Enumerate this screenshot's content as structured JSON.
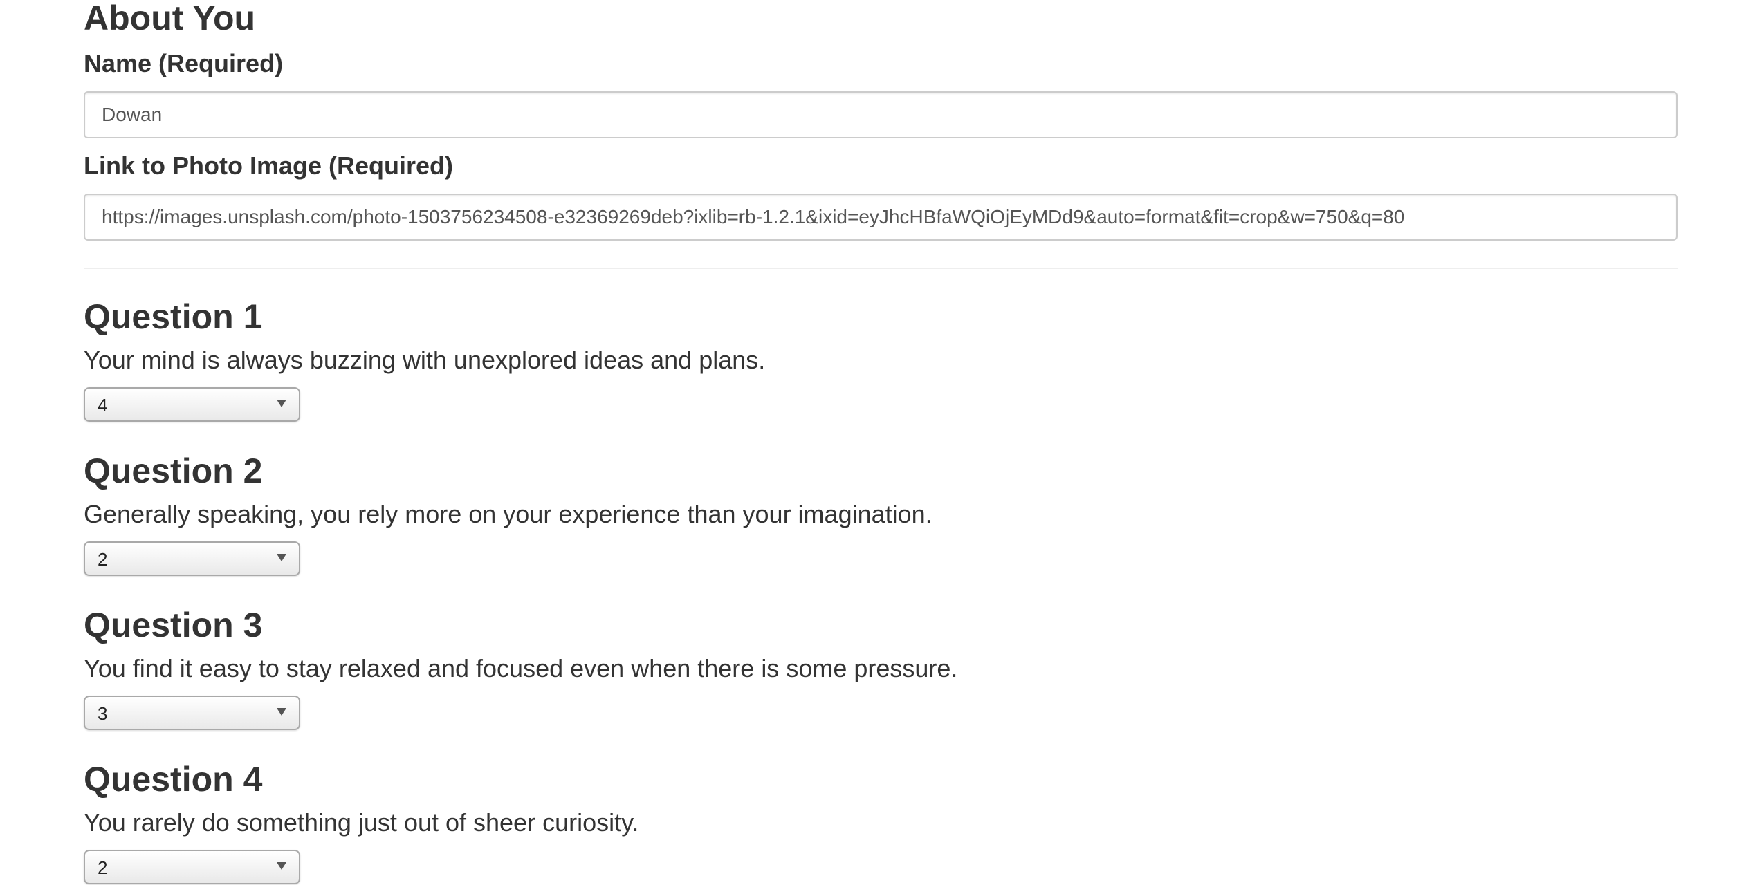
{
  "about": {
    "title": "About You",
    "name_label": "Name (Required)",
    "name_value": "Dowan",
    "photo_label": "Link to Photo Image (Required)",
    "photo_value": "https://images.unsplash.com/photo-1503756234508-e32369269deb?ixlib=rb-1.2.1&ixid=eyJhcHBfaWQiOjEyMDd9&auto=format&fit=crop&w=750&q=80"
  },
  "questions": [
    {
      "title": "Question 1",
      "text": "Your mind is always buzzing with unexplored ideas and plans.",
      "selected": "4"
    },
    {
      "title": "Question 2",
      "text": "Generally speaking, you rely more on your experience than your imagination.",
      "selected": "2"
    },
    {
      "title": "Question 3",
      "text": "You find it easy to stay relaxed and focused even when there is some pressure.",
      "selected": "3"
    },
    {
      "title": "Question 4",
      "text": "You rarely do something just out of sheer curiosity.",
      "selected": "2"
    }
  ],
  "icons": {
    "select_arrow": "triangle-down-icon"
  }
}
